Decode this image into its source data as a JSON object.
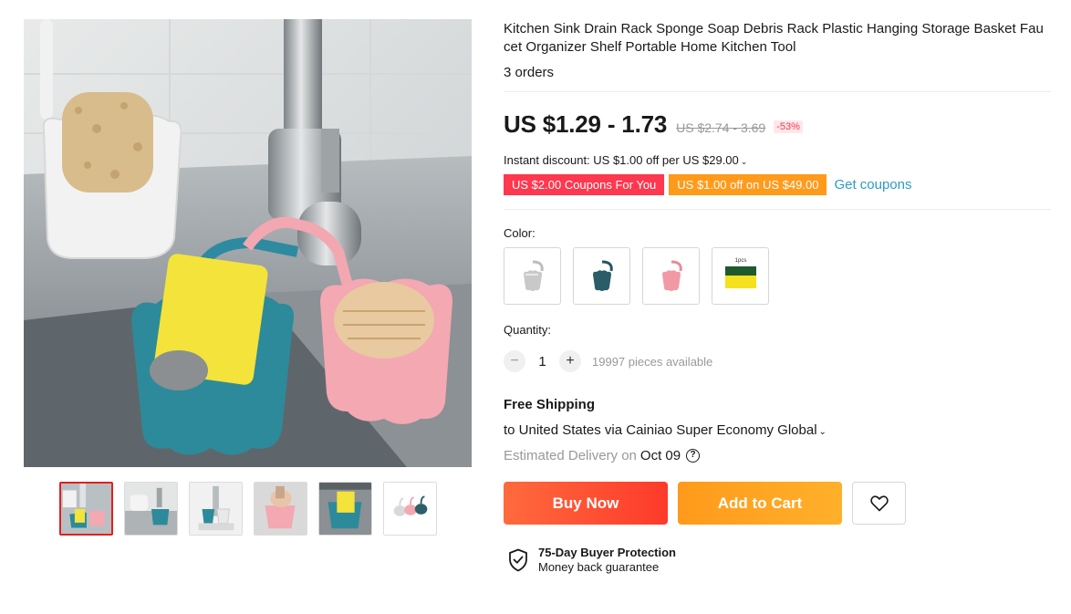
{
  "product": {
    "title": "Kitchen Sink Drain Rack Sponge Soap Debris Rack Plastic Hanging Storage Basket Faucet Organizer Shelf Portable Home Kitchen Tool",
    "orders": "3 orders"
  },
  "price": {
    "current": "US $1.29 - 1.73",
    "original": "US $2.74 - 3.69",
    "discount": "-53%",
    "instant_discount": "Instant discount: US $1.00 off per US $29.00"
  },
  "coupons": {
    "coupon1": "US $2.00 Coupons For You",
    "coupon2": "US $1.00 off on US $49.00",
    "get_label": "Get coupons"
  },
  "color": {
    "label": "Color:",
    "options": [
      "gray",
      "dark-green",
      "pink",
      "sponge-1pcs"
    ],
    "sponge_badge": "1pcs"
  },
  "quantity": {
    "label": "Quantity:",
    "value": "1",
    "available": "19997 pieces available",
    "minus": "−",
    "plus": "+"
  },
  "shipping": {
    "title": "Free Shipping",
    "to": "to United States via Cainiao Super Economy Global",
    "estimated_label": "Estimated Delivery on",
    "date": "Oct 09",
    "help": "?"
  },
  "buttons": {
    "buy": "Buy Now",
    "cart": "Add to Cart"
  },
  "protection": {
    "title": "75-Day Buyer Protection",
    "subtitle": "Money back guarantee"
  },
  "colors": {
    "red": "#fd384f",
    "orange": "#ff9a1b",
    "link": "#2e9cc3"
  }
}
